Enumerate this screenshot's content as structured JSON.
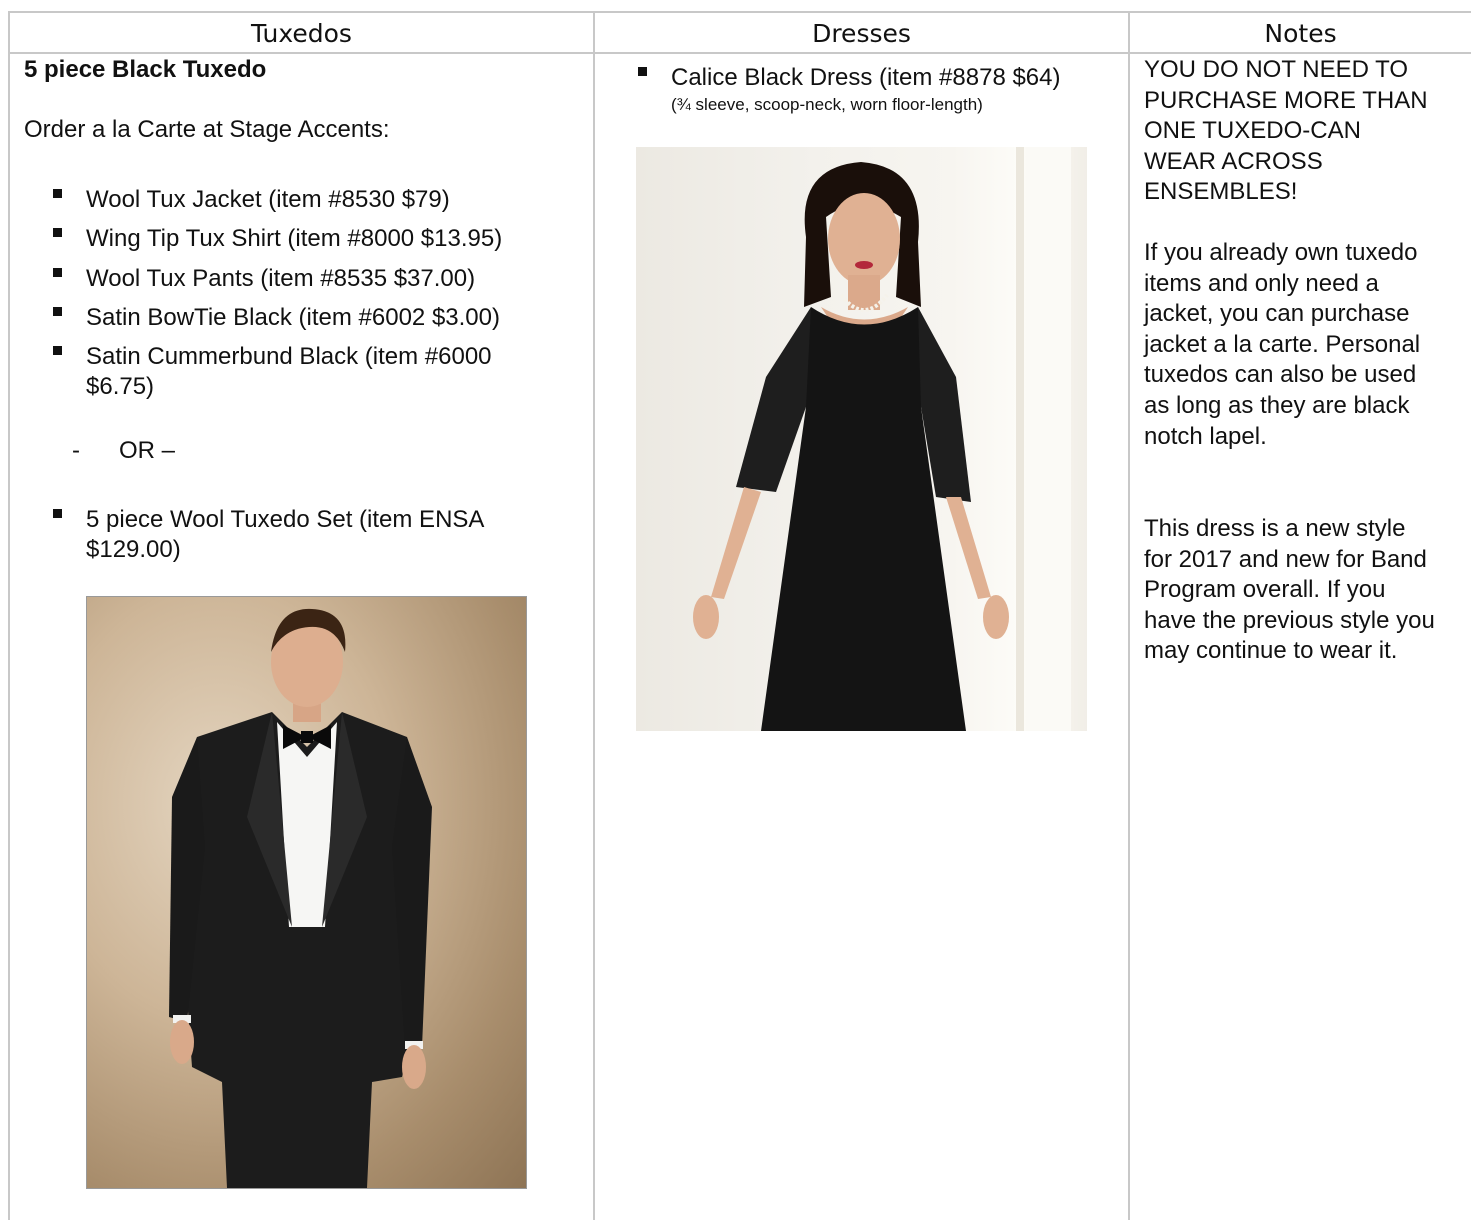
{
  "table": {
    "headers": [
      "Tuxedos",
      "Dresses",
      "Notes"
    ]
  },
  "tuxedos": {
    "title": "5 piece Black Tuxedo",
    "intro": "Order a la Carte at Stage Accents:",
    "items": [
      "Wool Tux Jacket (item #8530 $79)",
      "Wing Tip Tux Shirt (item #8000 $13.95)",
      "Wool Tux Pants (item #8535 $37.00)",
      "Satin BowTie Black (item #6002 $3.00)",
      "Satin Cummerbund Black (item #6000 $6.75)"
    ],
    "or_dash": "-",
    "or_label": "OR –",
    "set_item": "5 piece Wool Tuxedo Set (item ENSA $129.00)"
  },
  "dresses": {
    "item": "Calice Black Dress (item #8878 $64)",
    "detail": "(¾ sleeve, scoop-neck, worn floor-length)"
  },
  "notes": {
    "para1": "YOU DO NOT NEED TO\nPURCHASE MORE THAN\nONE TUXEDO-CAN\nWEAR ACROSS\nENSEMBLES!",
    "para2": "If you already own tuxedo\nitems and only need a\njacket, you can purchase\njacket a la carte.  Personal\ntuxedos can also be used\nas long as they are black\nnotch lapel.",
    "para3": "This dress is a new style\nfor 2017 and new for Band\nProgram overall.  If you\nhave the previous style you\nmay continue to wear it."
  },
  "icons": {
    "bullet": "square-bullet-icon"
  }
}
